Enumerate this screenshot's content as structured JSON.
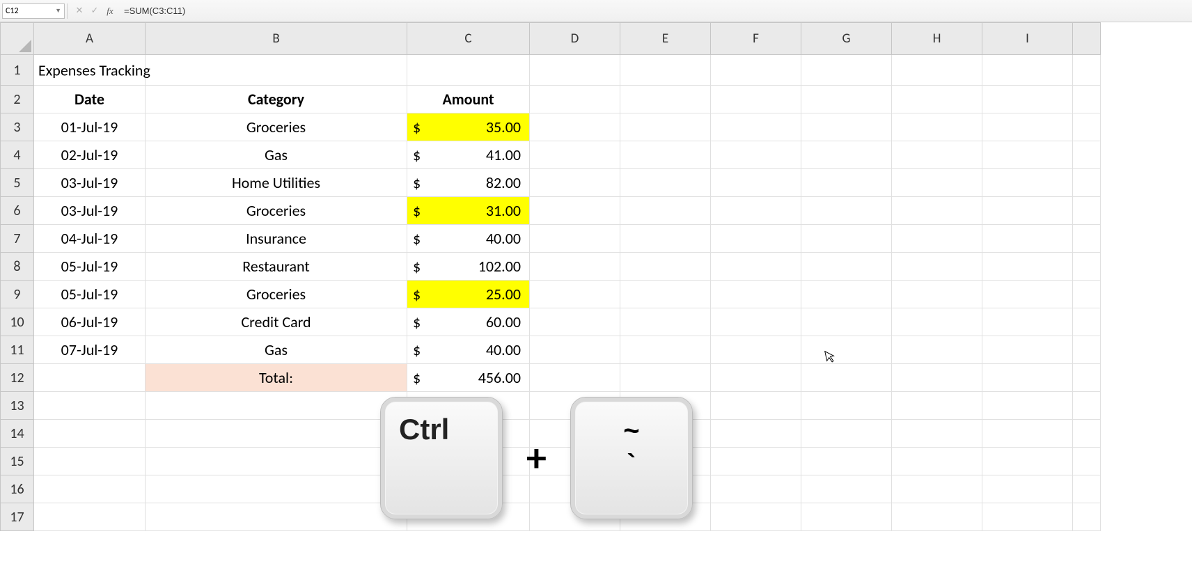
{
  "formula_bar": {
    "name_box": "C12",
    "formula": "=SUM(C3:C11)"
  },
  "columns": [
    "A",
    "B",
    "C",
    "D",
    "E",
    "F",
    "G",
    "H",
    "I"
  ],
  "row_numbers": [
    "1",
    "2",
    "3",
    "4",
    "5",
    "6",
    "7",
    "8",
    "9",
    "10",
    "11",
    "12",
    "13",
    "14",
    "15",
    "16",
    "17"
  ],
  "title": "Expenses Tracking",
  "headers": {
    "date": "Date",
    "category": "Category",
    "amount": "Amount"
  },
  "currency_symbol": "$",
  "rows": [
    {
      "date": "01-Jul-19",
      "category": "Groceries",
      "amount": "35.00",
      "highlight": true
    },
    {
      "date": "02-Jul-19",
      "category": "Gas",
      "amount": "41.00",
      "highlight": false
    },
    {
      "date": "03-Jul-19",
      "category": "Home Utilities",
      "amount": "82.00",
      "highlight": false
    },
    {
      "date": "03-Jul-19",
      "category": "Groceries",
      "amount": "31.00",
      "highlight": true
    },
    {
      "date": "04-Jul-19",
      "category": "Insurance",
      "amount": "40.00",
      "highlight": false
    },
    {
      "date": "05-Jul-19",
      "category": "Restaurant",
      "amount": "102.00",
      "highlight": false
    },
    {
      "date": "05-Jul-19",
      "category": "Groceries",
      "amount": "25.00",
      "highlight": true
    },
    {
      "date": "06-Jul-19",
      "category": "Credit Card",
      "amount": "60.00",
      "highlight": false
    },
    {
      "date": "07-Jul-19",
      "category": "Gas",
      "amount": "40.00",
      "highlight": false
    }
  ],
  "total": {
    "label": "Total:",
    "amount": "456.00"
  },
  "keys": {
    "ctrl": "Ctrl",
    "plus": "+",
    "tilde_top": "~",
    "tilde_bottom": "`"
  }
}
